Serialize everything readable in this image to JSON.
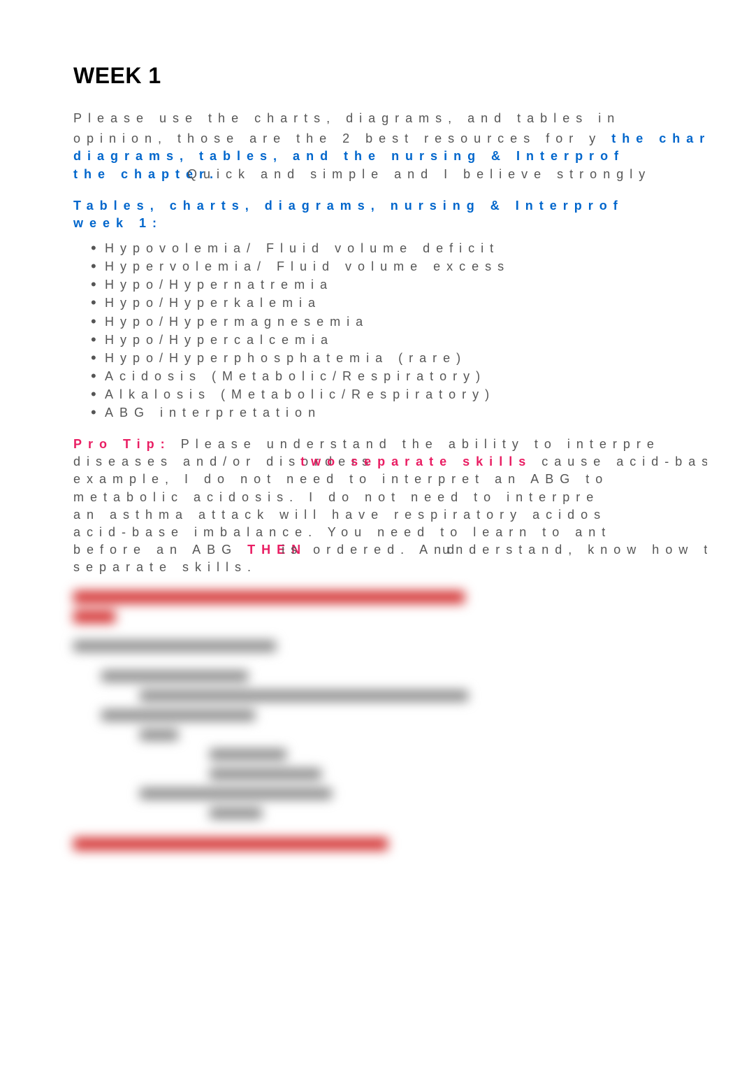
{
  "title": "WEEK 1",
  "intro": {
    "line1": "Please use the charts, diagrams, and tables in",
    "line2_gray": "opinion, those are the 2 best resources for y",
    "line2_blue_overlay": "the charts,",
    "line3": "diagrams, tables, and the nursing & Interprof",
    "line4_blue": "the chapter.",
    "line4_gray_overlay": "Quick and simple and I believe strongly"
  },
  "topics_header": {
    "line1": "Tables, charts, diagrams, nursing & Interprof",
    "line2": "week 1:"
  },
  "bullets": [
    "Hypovolemia/ Fluid volume deficit",
    "Hypervolemia/ Fluid volume excess",
    "Hypo/Hypernatremia",
    "Hypo/Hyperkalemia",
    "Hypo/Hypermagnesemia",
    "Hypo/Hypercalcemia",
    "Hypo/Hyperphosphatemia (rare)",
    "Acidosis (Metabolic/Respiratory)",
    "Alkalosis (Metabolic/Respiratory)",
    "ABG interpretation"
  ],
  "protip": {
    "label": "Pro Tip:",
    "line1_a": "Please understand the ability to interpre",
    "line2_a": "diseases and/or disorders ",
    "line2_pink": "two separate skills",
    "line2_b": "cause acid-base For i",
    "line3": "example, I do not need to interpret an ABG to",
    "line4": "metabolic acidosis. I do not need to interpre",
    "line5": "an asthma attack will have respiratory acidos",
    "line6": "acid-base imbalance. You need to learn to ant",
    "line7_a": "before an ABG ",
    "line7_pink": "THEN",
    "line7_b": "is ordered. And",
    "line7_c": "know how to in",
    "line7_overlay": "understand, ",
    "line8": "separate skills."
  }
}
